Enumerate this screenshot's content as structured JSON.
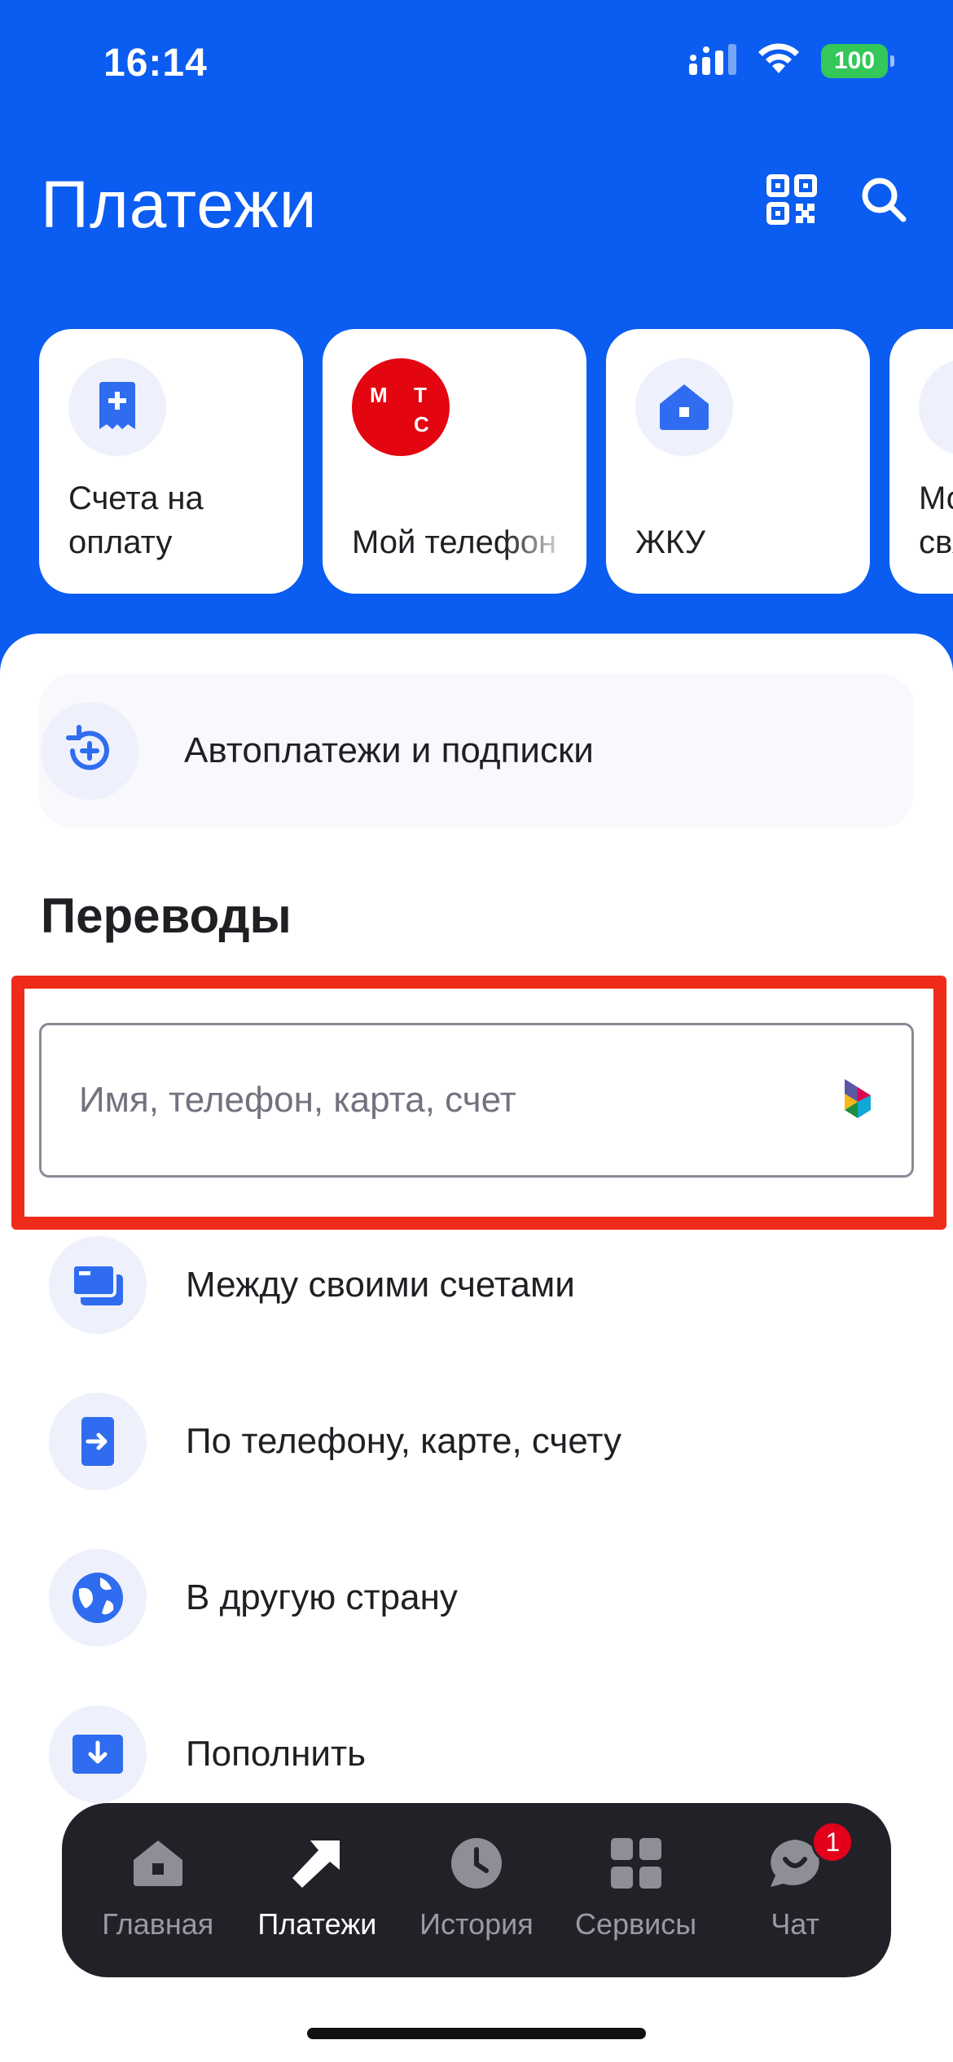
{
  "status_bar": {
    "time": "16:14",
    "battery": "100",
    "signal_icon": "signal-icon",
    "wifi_icon": "wifi-icon"
  },
  "header": {
    "title": "Платежи",
    "qr_icon": "qr-code-icon",
    "search_icon": "search-icon"
  },
  "quick_tiles": [
    {
      "label": "Счета на оплату",
      "icon": "receipt-icon"
    },
    {
      "label": "Мой телефон",
      "icon": "mts-logo",
      "logo_letters": [
        "М",
        "Т",
        "С"
      ]
    },
    {
      "label": "ЖКУ",
      "icon": "house-icon"
    },
    {
      "label": "Мобильная связь",
      "icon": "phone-icon"
    }
  ],
  "autopay": {
    "label": "Автоплатежи и подписки",
    "icon": "autopay-icon"
  },
  "transfers": {
    "title": "Переводы",
    "search_placeholder": "Имя, телефон, карта, счет",
    "items": [
      {
        "label": "Между своими счетами",
        "icon": "cards-icon"
      },
      {
        "label": "По телефону, карте, счету",
        "icon": "transfer-out-icon"
      },
      {
        "label": "В другую страну",
        "icon": "globe-icon"
      },
      {
        "label": "Пополнить",
        "icon": "top-up-icon"
      }
    ]
  },
  "bottom_nav": {
    "items": [
      {
        "label": "Главная",
        "icon": "home-icon"
      },
      {
        "label": "Платежи",
        "icon": "payments-arrow-icon",
        "active": true
      },
      {
        "label": "История",
        "icon": "clock-icon"
      },
      {
        "label": "Сервисы",
        "icon": "grid-icon"
      },
      {
        "label": "Чат",
        "icon": "chat-icon",
        "badge": "1"
      }
    ]
  },
  "colors": {
    "brand_blue": "#0b5cf0",
    "accent_icon_blue": "#3a73f0",
    "highlight_red": "#ef2b1a",
    "nav_bg": "#232128",
    "mts_red": "#e30611"
  }
}
